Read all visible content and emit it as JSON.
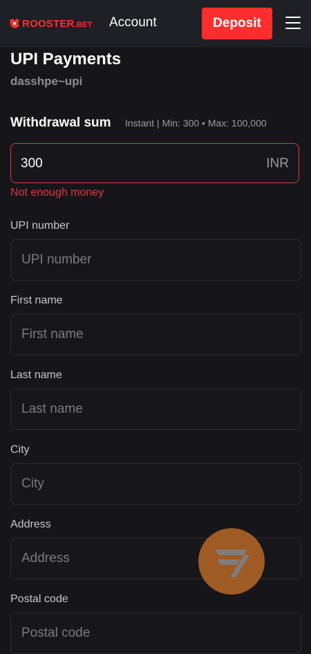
{
  "header": {
    "brand_name": "ROOSTER",
    "brand_suffix": ".BET",
    "account_label": "Account",
    "deposit_label": "Deposit",
    "brand_color": "#ff2d2d"
  },
  "page": {
    "title": "UPI Payments",
    "subtitle": "dasshpe~upi"
  },
  "withdrawal": {
    "label": "Withdrawal sum",
    "info": "Instant | Min: 300 • Max: 100,000",
    "amount": "300",
    "currency": "INR",
    "error": "Not enough money",
    "error_color": "#e0393f"
  },
  "fields": [
    {
      "label": "UPI number",
      "placeholder": "UPI number"
    },
    {
      "label": "First name",
      "placeholder": "First name"
    },
    {
      "label": "Last name",
      "placeholder": "Last name"
    },
    {
      "label": "City",
      "placeholder": "City"
    },
    {
      "label": "Address",
      "placeholder": "Address"
    },
    {
      "label": "Postal code",
      "placeholder": "Postal code"
    }
  ],
  "icons": {
    "menu": "hamburger-menu-icon",
    "chat": "chat-widget-icon"
  }
}
